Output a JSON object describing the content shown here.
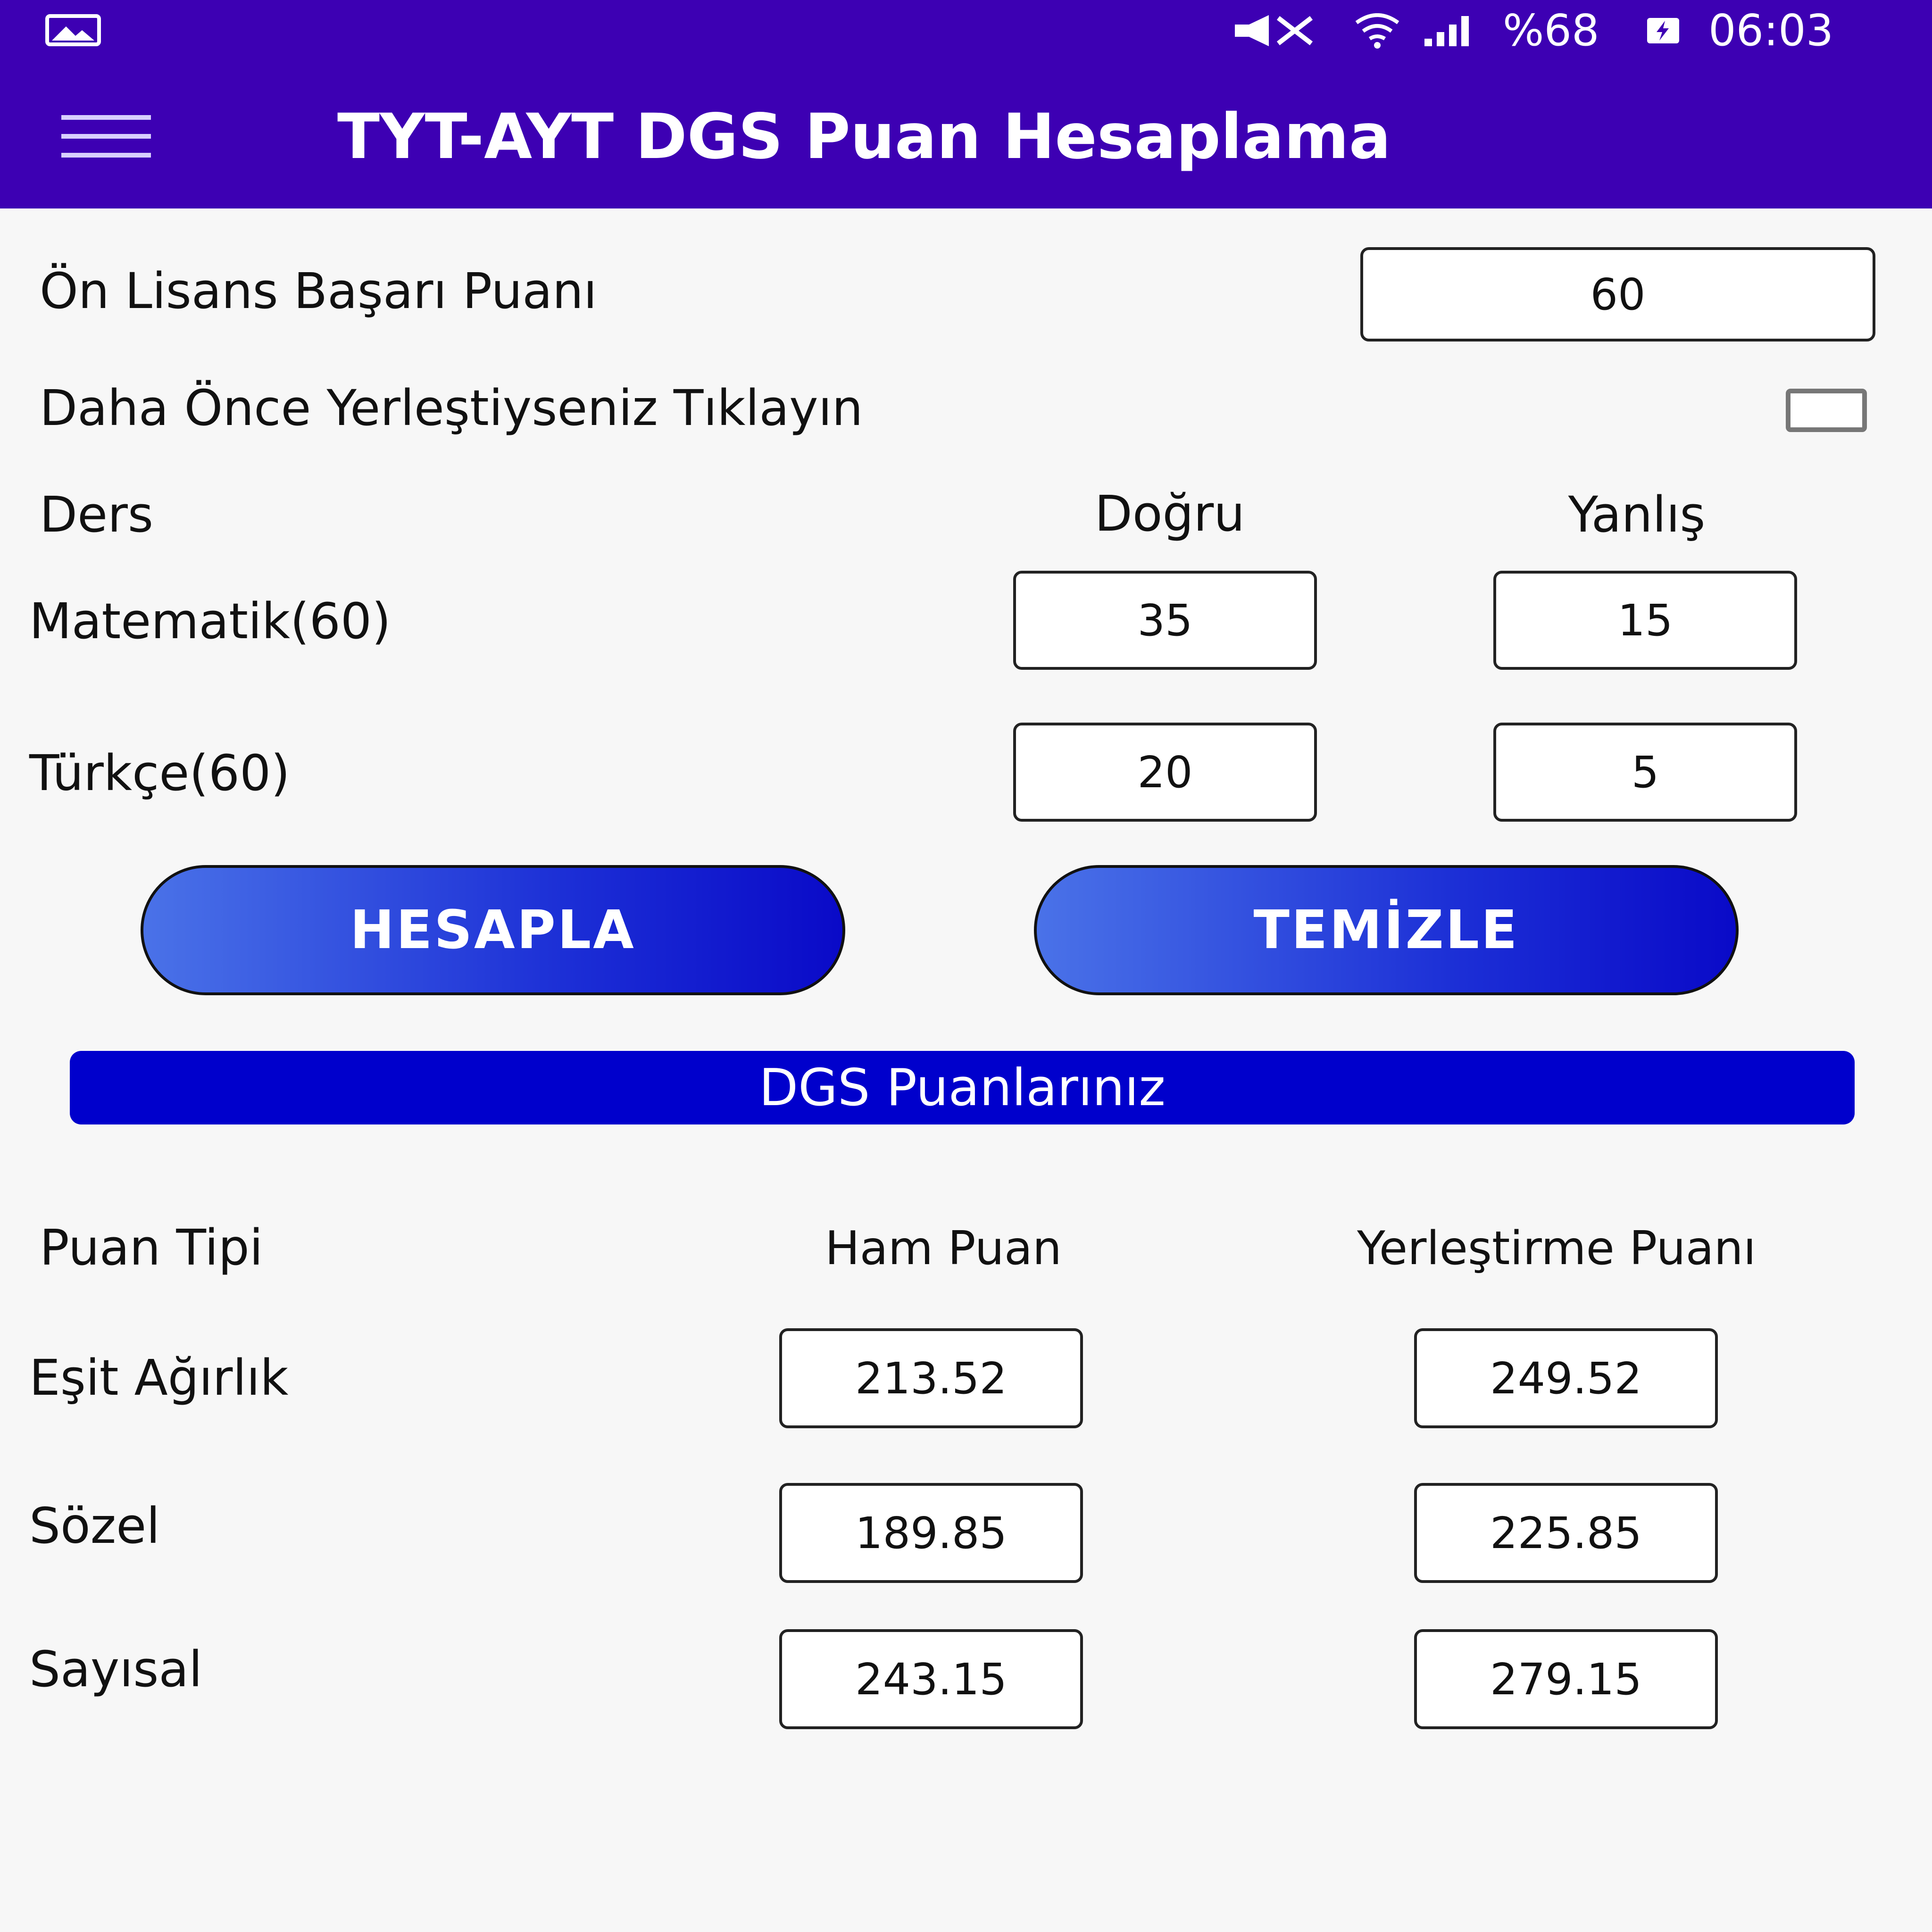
{
  "colors": {
    "appbar": "#3d00b3",
    "button_start": "#4a72e8",
    "button_end": "#0a0ac8",
    "banner": "#0000cc"
  },
  "status_bar": {
    "battery": "%68",
    "time": "06:03",
    "icons": [
      "gallery-icon",
      "mute-icon",
      "wifi-icon",
      "signal-icon",
      "battery-icon"
    ]
  },
  "app_bar": {
    "title": "TYT-AYT DGS Puan Hesaplama",
    "menu_icon": "hamburger-menu-icon"
  },
  "form": {
    "on_lisans_label": "Ön Lisans Başarı Puanı",
    "on_lisans_value": "60",
    "prev_placed_label": "Daha Önce Yerleştiyseniz Tıklayın",
    "prev_placed_checked": false,
    "headers": {
      "ders": "Ders",
      "dogru": "Doğru",
      "yanlis": "Yanlış"
    },
    "rows": [
      {
        "label": "Matematik(60)",
        "dogru": "35",
        "yanlis": "15"
      },
      {
        "label": "Türkçe(60)",
        "dogru": "20",
        "yanlis": "5"
      }
    ]
  },
  "buttons": {
    "calculate": "HESAPLA",
    "clear": "TEMİZLE"
  },
  "results": {
    "banner": "DGS Puanlarınız",
    "headers": {
      "type": "Puan Tipi",
      "raw": "Ham Puan",
      "placement": "Yerleştirme Puanı"
    },
    "rows": [
      {
        "label": "Eşit Ağırlık",
        "raw": "213.52",
        "placement": "249.52"
      },
      {
        "label": "Sözel",
        "raw": "189.85",
        "placement": "225.85"
      },
      {
        "label": "Sayısal",
        "raw": "243.15",
        "placement": "279.15"
      }
    ]
  }
}
